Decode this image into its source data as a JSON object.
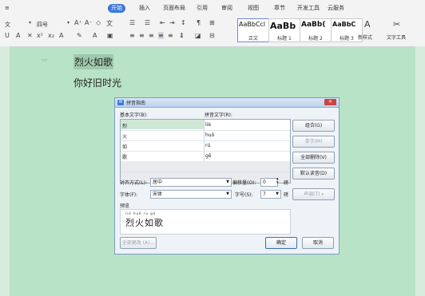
{
  "ribbon": {
    "top_left_icon": "≡",
    "tabs": [
      {
        "label": "开始",
        "active": true
      },
      {
        "label": "插入"
      },
      {
        "label": "页面布局"
      },
      {
        "label": "引用"
      },
      {
        "label": "审阅"
      },
      {
        "label": "视图"
      },
      {
        "label": "章节"
      },
      {
        "label": "开发工具"
      },
      {
        "label": "云服务"
      }
    ],
    "font_name": "文",
    "font_size": "四号",
    "styles": [
      {
        "sample": "AaBbCcl",
        "label": "正文"
      },
      {
        "sample": "AaBb",
        "label": "标题 1"
      },
      {
        "sample": "AaBb(",
        "label": "标题 2"
      },
      {
        "sample": "AaBbC",
        "label": "标题 3"
      }
    ],
    "new_style_label": "新样式",
    "text_tools_label": "文字工具"
  },
  "document": {
    "line1": "烈火如歌",
    "line2": "你好旧时光"
  },
  "dialog": {
    "title": "拼音指南",
    "base_text_label": "基本文字(B):",
    "pinyin_text_label": "拼音文字(R):",
    "rows": [
      {
        "char": "烈",
        "pinyin": "liè"
      },
      {
        "char": "火",
        "pinyin": "huǒ"
      },
      {
        "char": "如",
        "pinyin": "rú"
      },
      {
        "char": "歌",
        "pinyin": "gē"
      }
    ],
    "buttons": {
      "combine": "组合(G)",
      "single": "单字(M)",
      "clear_all": "全部删除(V)",
      "default_reading": "默认读音(D)",
      "voice": "声调(T)",
      "apply_all": "全部更改 (A)...",
      "ok": "确定",
      "cancel": "取消"
    },
    "alignment_label": "对齐方式(L):",
    "alignment_value": "居中",
    "offset_label": "偏移量(O):",
    "offset_value": "0",
    "offset_unit": "磅",
    "font_label": "字体(F):",
    "font_value": "宋体",
    "size_label": "字号(S):",
    "size_value": "7",
    "size_unit": "磅",
    "preview_label": "预览",
    "preview_pinyin": "liè huǒ rú gē",
    "preview_text": "烈火如歌"
  }
}
